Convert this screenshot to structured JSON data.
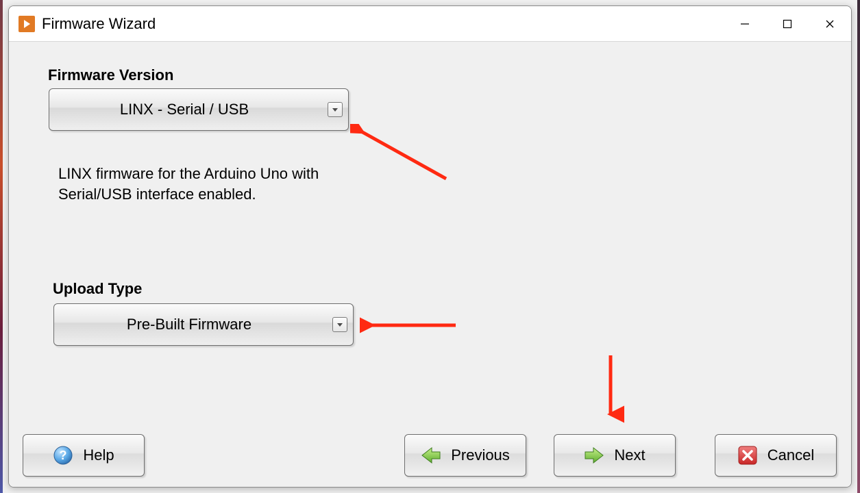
{
  "window": {
    "title": "Firmware Wizard"
  },
  "labels": {
    "firmware_version": "Firmware Version",
    "upload_type": "Upload Type"
  },
  "combos": {
    "firmware_version_selected": "LINX - Serial / USB",
    "upload_type_selected": "Pre-Built Firmware"
  },
  "description": {
    "line1": "LINX firmware for the Arduino Uno with",
    "line2": "Serial/USB interface enabled."
  },
  "buttons": {
    "help": "Help",
    "previous": "Previous",
    "next": "Next",
    "cancel": "Cancel"
  }
}
